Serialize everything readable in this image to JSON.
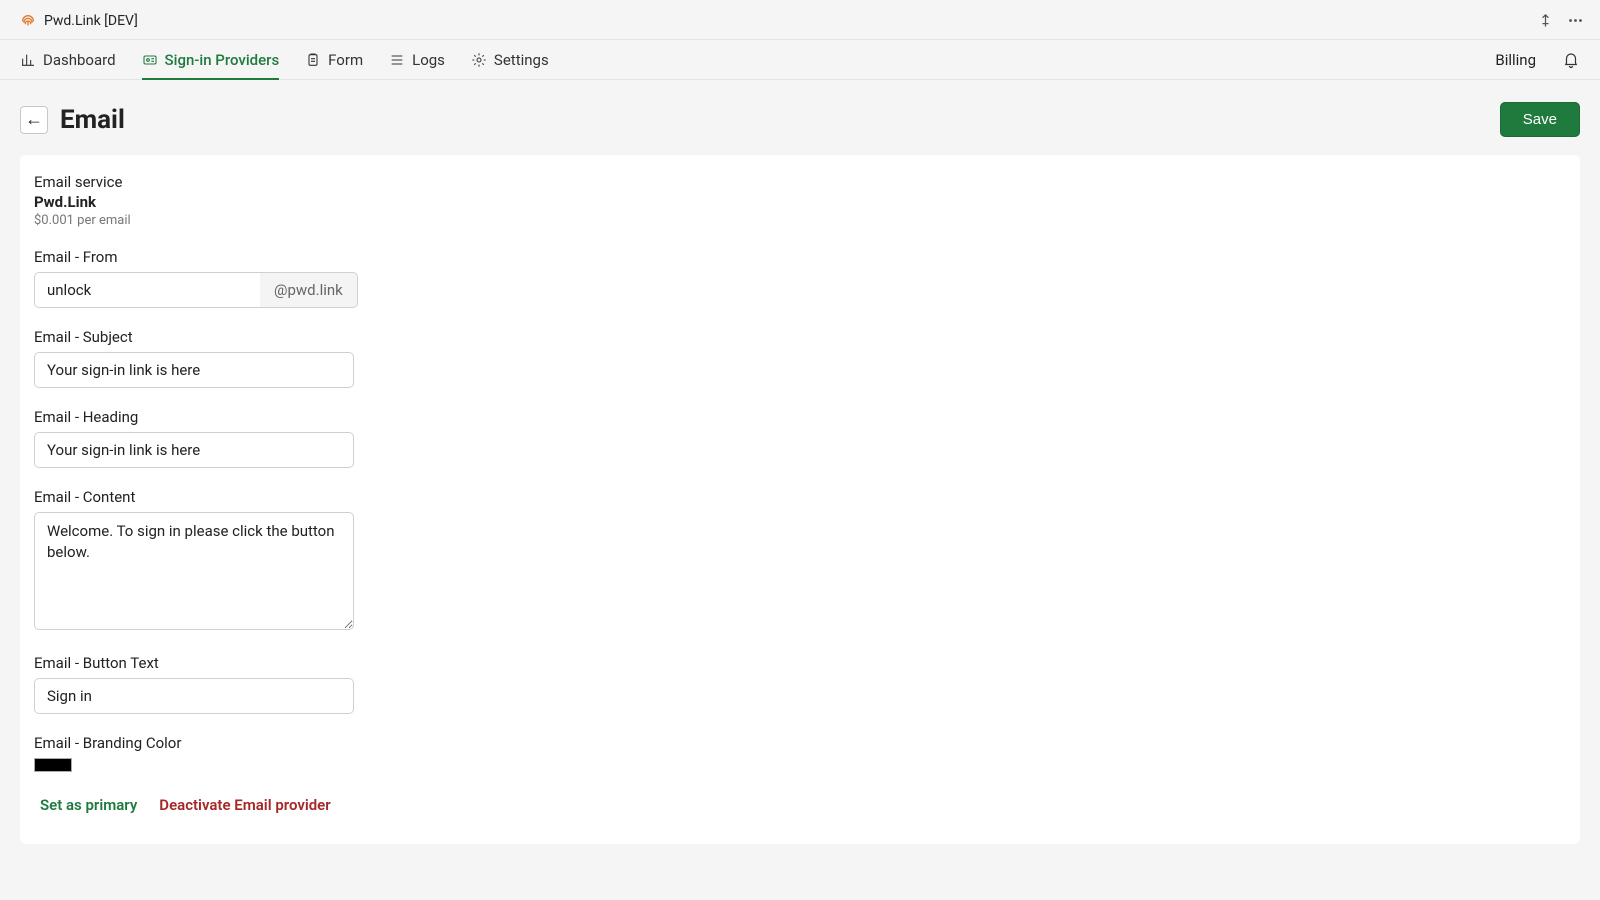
{
  "app": {
    "title": "Pwd.Link [DEV]"
  },
  "nav": {
    "items": [
      {
        "label": "Dashboard"
      },
      {
        "label": "Sign-in Providers"
      },
      {
        "label": "Form"
      },
      {
        "label": "Logs"
      },
      {
        "label": "Settings"
      }
    ],
    "billing_label": "Billing"
  },
  "page": {
    "back_symbol": "←",
    "title": "Email",
    "save_label": "Save"
  },
  "service": {
    "label": "Email service",
    "name": "Pwd.Link",
    "cost": "$0.001 per email"
  },
  "form": {
    "from": {
      "label": "Email - From",
      "value": "unlock",
      "domain": "@pwd.link"
    },
    "subject": {
      "label": "Email - Subject",
      "value": "Your sign-in link is here"
    },
    "heading": {
      "label": "Email - Heading",
      "value": "Your sign-in link is here"
    },
    "content": {
      "label": "Email - Content",
      "value": "Welcome. To sign in please click the button below."
    },
    "button_text": {
      "label": "Email - Button Text",
      "value": "Sign in"
    },
    "branding_color": {
      "label": "Email - Branding Color",
      "value": "#000000"
    }
  },
  "actions": {
    "set_primary": "Set as primary",
    "deactivate": "Deactivate Email provider"
  }
}
